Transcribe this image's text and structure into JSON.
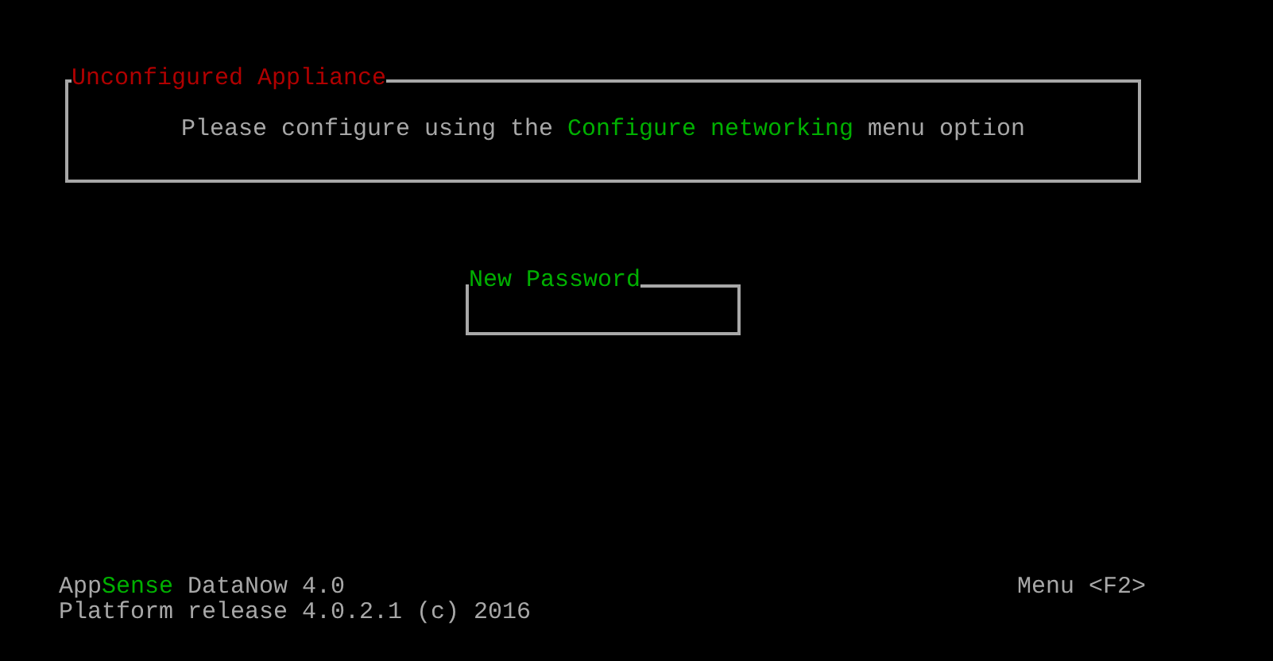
{
  "notice": {
    "title": "Unconfigured Appliance",
    "message": "Please configure using the **Configure networking** menu option"
  },
  "password": {
    "label": "New Password"
  },
  "footer": {
    "product": "App**Sense** DataNow 4.0",
    "release": "Platform release 4.0.2.1 (c) 2016",
    "menu": "Menu <F2>"
  }
}
